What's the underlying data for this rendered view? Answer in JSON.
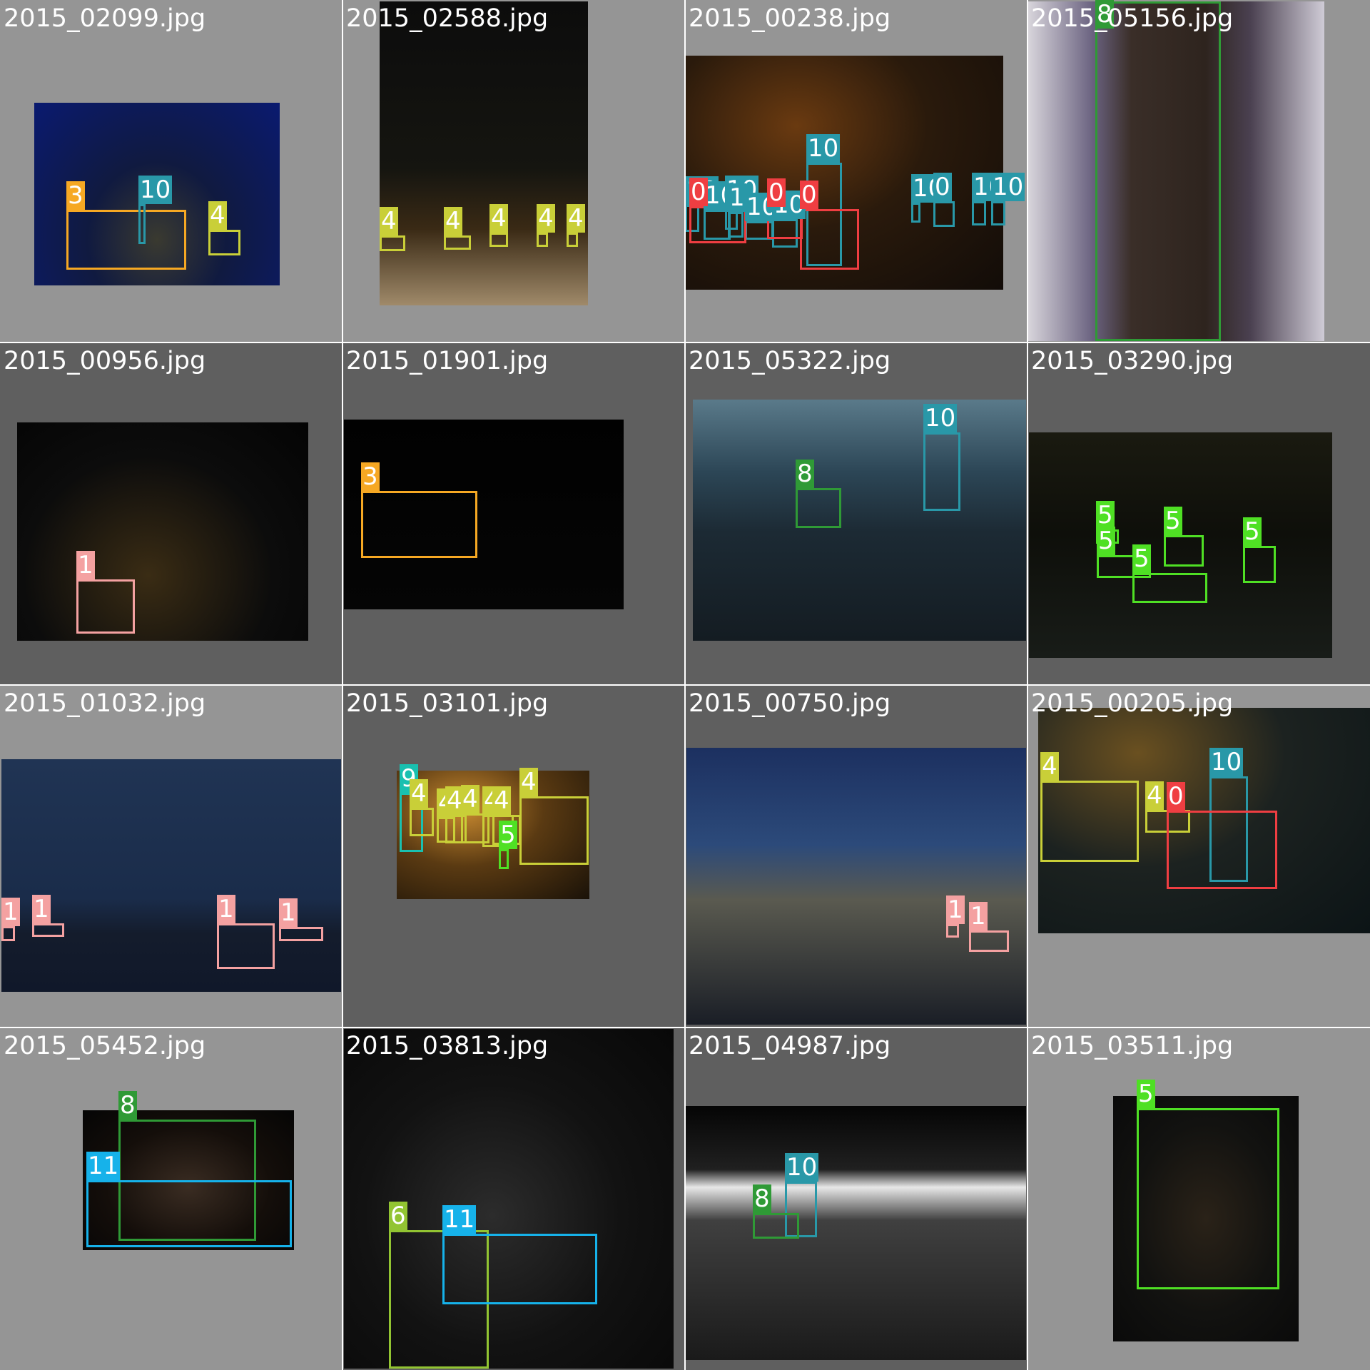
{
  "colors": {
    "c0": "#ef3e42",
    "c1": "#f4a1a1",
    "c3": "#f6a823",
    "c4": "#c9cf38",
    "c5": "#4fe024",
    "c6": "#92c432",
    "c8": "#2f9a36",
    "c9": "#19c0b0",
    "c10": "#2998a8",
    "c11": "#16b2ea"
  },
  "tiles": [
    {
      "filename": "2015_02099.jpg",
      "background": "#959595",
      "photo_style": "radial-gradient(ellipse at 50% 75%, #3a3a30 0%, #101a40 40%, #0a1a70 100%)",
      "boxes": [
        {
          "label": "3",
          "color": "c3"
        },
        {
          "label": "10",
          "color": "c10"
        },
        {
          "label": "4",
          "color": "c4"
        }
      ]
    },
    {
      "filename": "2015_02588.jpg",
      "background": "#959595",
      "photo_style": "linear-gradient(180deg, #0c0c0c 0%, #151510 55%, #3a2a15 75%, #a08a6a 100%)",
      "boxes": [
        {
          "label": "4",
          "color": "c4"
        },
        {
          "label": "4",
          "color": "c4"
        },
        {
          "label": "4",
          "color": "c4"
        },
        {
          "label": "4",
          "color": "c4"
        },
        {
          "label": "4",
          "color": "c4"
        }
      ]
    },
    {
      "filename": "2015_00238.jpg",
      "background": "#959595",
      "photo_style": "radial-gradient(ellipse at 35% 30%, #6a3a10 0%, #2a1a0c 45%, #120c08 100%)",
      "boxes": [
        {
          "label": "10",
          "color": "c10"
        },
        {
          "label": "10",
          "color": "c10"
        },
        {
          "label": "10",
          "color": "c10"
        },
        {
          "label": "1",
          "color": "c10"
        },
        {
          "label": "10",
          "color": "c10"
        },
        {
          "label": "0",
          "color": "c0"
        },
        {
          "label": "10",
          "color": "c10"
        },
        {
          "label": "0",
          "color": "c0"
        },
        {
          "label": "10",
          "color": "c10"
        },
        {
          "label": "10",
          "color": "c10"
        },
        {
          "label": "0",
          "color": "c10"
        },
        {
          "label": "10",
          "color": "c10"
        },
        {
          "label": "10",
          "color": "c10"
        },
        {
          "label": "0",
          "color": "c0"
        }
      ]
    },
    {
      "filename": "2015_05156.jpg",
      "background": "#959595",
      "photo_style": "linear-gradient(90deg, #d9d6dc 0%, #6a6280 22%, #3a2e28 35%, #2e241e 60%, #4a4050 75%, #cfcbd6 100%)",
      "boxes": [
        {
          "label": "8",
          "color": "c8"
        }
      ]
    },
    {
      "filename": "2015_00956.jpg",
      "background": "#5f5f5f",
      "photo_style": "radial-gradient(ellipse at 45% 70%, #3a2c14 0%, #0c0c0c 55%, #040404 100%)",
      "boxes": [
        {
          "label": "1",
          "color": "c1"
        }
      ]
    },
    {
      "filename": "2015_01901.jpg",
      "background": "#5f5f5f",
      "photo_style": "linear-gradient(180deg, #010101 0%, #050505 100%)",
      "boxes": [
        {
          "label": "3",
          "color": "c3"
        }
      ]
    },
    {
      "filename": "2015_05322.jpg",
      "background": "#5f5f5f",
      "photo_style": "linear-gradient(180deg, #5a7a8a 0%, #2c4656 30%, #1c2a34 55%, #141c22 100%)",
      "boxes": [
        {
          "label": "10",
          "color": "c10"
        },
        {
          "label": "8",
          "color": "c8"
        }
      ]
    },
    {
      "filename": "2015_03290.jpg",
      "background": "#5f5f5f",
      "photo_style": "linear-gradient(180deg, #1a1a10 0%, #0e0f0a 45%, #181c18 100%)",
      "boxes": [
        {
          "label": "5",
          "color": "c5"
        },
        {
          "label": "5",
          "color": "c5"
        },
        {
          "label": "5",
          "color": "c5"
        },
        {
          "label": "5",
          "color": "c5"
        },
        {
          "label": "5",
          "color": "c5"
        }
      ]
    },
    {
      "filename": "2015_01032.jpg",
      "background": "#959595",
      "photo_style": "linear-gradient(180deg, #203454 0%, #1a2c4a 60%, #141c2c 75%, #10182a 100%)",
      "boxes": [
        {
          "label": "1",
          "color": "c1"
        },
        {
          "label": "1",
          "color": "c1"
        },
        {
          "label": "1",
          "color": "c1"
        },
        {
          "label": "1",
          "color": "c1"
        }
      ]
    },
    {
      "filename": "2015_03101.jpg",
      "background": "#5f5f5f",
      "photo_style": "radial-gradient(ellipse at 35% 30%, #c98a30 0%, #5a3a12 45%, #1a1208 100%)",
      "boxes": [
        {
          "label": "9",
          "color": "c9"
        },
        {
          "label": "4",
          "color": "c4"
        },
        {
          "label": "4",
          "color": "c4"
        },
        {
          "label": "4",
          "color": "c4"
        },
        {
          "label": "4",
          "color": "c4"
        },
        {
          "label": "4",
          "color": "c4"
        },
        {
          "label": "4",
          "color": "c4"
        },
        {
          "label": "4",
          "color": "c4"
        },
        {
          "label": "5",
          "color": "c5"
        }
      ]
    },
    {
      "filename": "2015_00750.jpg",
      "background": "#5f5f5f",
      "photo_style": "linear-gradient(180deg, #1c3060 0%, #2c4a7a 35%, #5a5a50 55%, #1a1e26 100%)",
      "boxes": [
        {
          "label": "1",
          "color": "c1"
        },
        {
          "label": "1",
          "color": "c1"
        }
      ]
    },
    {
      "filename": "2015_00205.jpg",
      "background": "#959595",
      "photo_style": "radial-gradient(ellipse at 30% 20%, #6a5020 0%, #1c2220 45%, #0c1416 100%)",
      "boxes": [
        {
          "label": "4",
          "color": "c4"
        },
        {
          "label": "4",
          "color": "c4"
        },
        {
          "label": "10",
          "color": "c10"
        },
        {
          "label": "0",
          "color": "c0"
        }
      ]
    },
    {
      "filename": "2015_05452.jpg",
      "background": "#959595",
      "photo_style": "radial-gradient(ellipse at 50% 55%, #3a2c22 0%, #140e0a 55%, #050505 100%)",
      "boxes": [
        {
          "label": "8",
          "color": "c8"
        },
        {
          "label": "11",
          "color": "c11"
        }
      ]
    },
    {
      "filename": "2015_03813.jpg",
      "background": "#5f5f5f",
      "photo_style": "radial-gradient(ellipse at 45% 55%, #2c2c2c 0%, #121212 50%, #080808 100%)",
      "boxes": [
        {
          "label": "6",
          "color": "c6"
        },
        {
          "label": "11",
          "color": "c11"
        }
      ]
    },
    {
      "filename": "2015_04987.jpg",
      "background": "#5f5f5f",
      "photo_style": "linear-gradient(180deg, #050505 0%, #202020 25%, #e8e8e8 32%, #404040 45%, #1a1a1a 100%)",
      "boxes": [
        {
          "label": "10",
          "color": "c10"
        },
        {
          "label": "8",
          "color": "c8"
        }
      ]
    },
    {
      "filename": "2015_03511.jpg",
      "background": "#959595",
      "photo_style": "radial-gradient(ellipse at 50% 50%, #2a2218 0%, #121210 55%, #0a0a0a 100%)",
      "boxes": [
        {
          "label": "5",
          "color": "c5"
        }
      ]
    }
  ]
}
